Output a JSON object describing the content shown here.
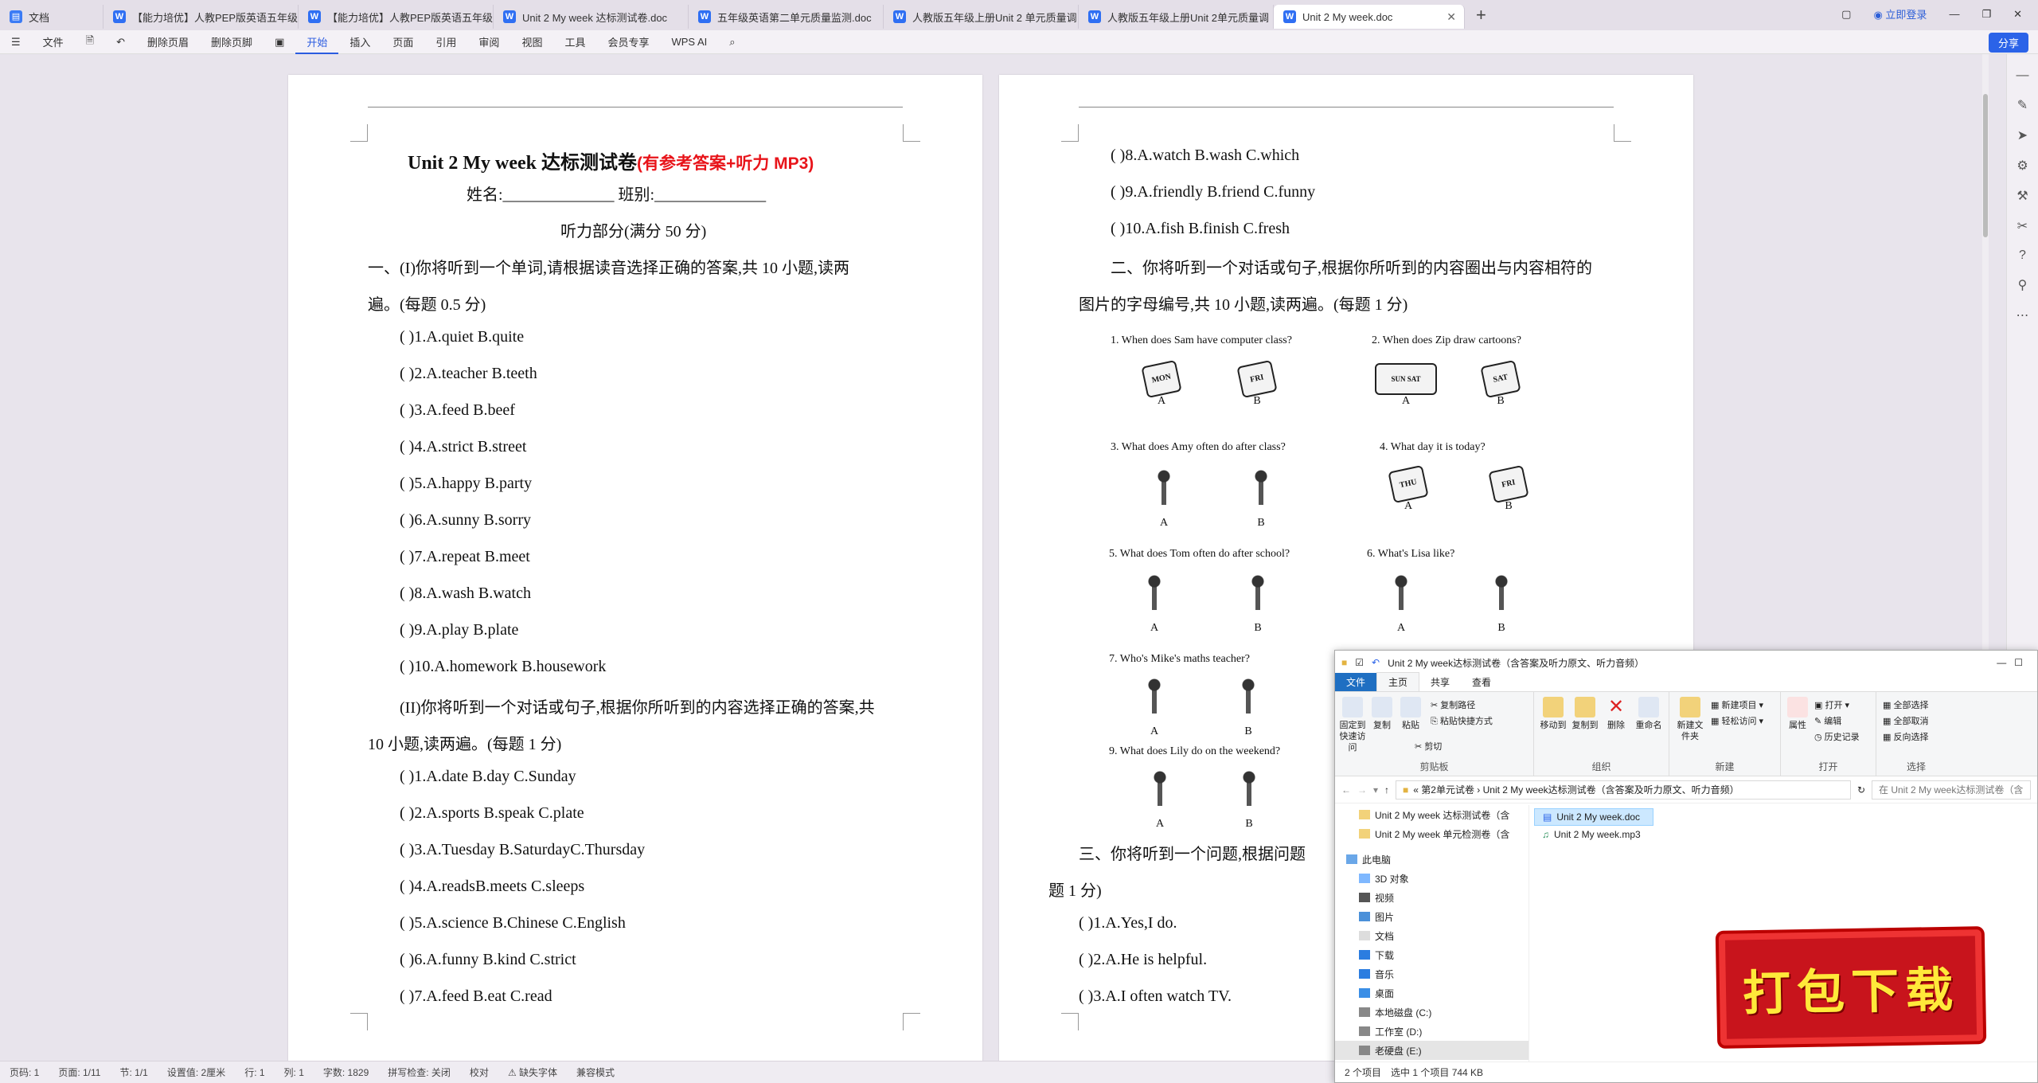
{
  "tabs": {
    "home": "文档",
    "items": [
      "【能力培优】人教PEP版英语五年级上",
      "【能力培优】人教PEP版英语五年级上",
      "Unit 2 My week 达标测试卷.doc",
      "五年级英语第二单元质量监测.doc",
      "人教版五年级上册Unit 2 单元质量调",
      "人教版五年级上册Unit 2单元质量调",
      "Unit 2   My week.doc"
    ],
    "login": "立即登录"
  },
  "menu": {
    "file": "文件",
    "tools": [
      "删除页眉",
      "删除页脚"
    ],
    "items": [
      "开始",
      "插入",
      "页面",
      "引用",
      "审阅",
      "视图",
      "工具",
      "会员专享"
    ],
    "ai": "WPS AI",
    "share": "分享"
  },
  "page1": {
    "title": "Unit 2    My week  达标测试卷",
    "title_note": "(有参考答案+听力 MP3)",
    "name_line": "姓名:______________       班别:______________",
    "listen_part": "听力部分(满分 50 分)",
    "section1_a": "一、(I)你将听到一个单词,请根据读音选择正确的答案,共 10 小题,读两",
    "section1_b": "遍。(每题 0.5 分)",
    "q1": [
      "(          )1.A.quiet          B.quite",
      "(          )2.A.teacher        B.teeth",
      "(          )3.A.feed               B.beef",
      "(          )4.A.strict             B.street",
      "(          )5.A.happy         B.party",
      "(          )6.A.sunny         B.sorry",
      "(          )7.A.repeat        B.meet",
      "(          )8.A.wash          B.watch",
      "(          )9.A.play              B.plate",
      "(          )10.A.homework   B.housework"
    ],
    "section2_a": "(II)你将听到一个对话或句子,根据你所听到的内容选择正确的答案,共",
    "section2_b": "10 小题,读两遍。(每题 1 分)",
    "q2": [
      "(                )1.A.date    B.day       C.Sunday",
      "(                )2.A.sports    B.speak    C.plate",
      "(                )3.A.Tuesday B.SaturdayC.Thursday",
      "(                )4.A.readsB.meets     C.sleeps",
      "(          )5.A.science    B.Chinese C.English",
      "(          )6.A.funny                   B.kind         C.strict",
      "(          )7.A.feed                     B.eat             C.read"
    ]
  },
  "page2": {
    "q1": [
      "(          )8.A.watch               B.wash          C.which",
      "(          )9.A.friendly             B.friend          C.funny",
      "(          )10.A.fish                 B.finish         C.fresh"
    ],
    "section2_a": "二、你将听到一个对话或句子,根据你所听到的内容圈出与内容相符的",
    "section2_b": "图片的字母编号,共 10 小题,读两遍。(每题 1 分)",
    "pic_questions": [
      "1.  When does Sam have computer class?",
      "2.  When does Zip draw cartoons?",
      "3.  What does Amy often do after class?",
      "4.  What day it is today?",
      "5.  What does Tom often do after school?",
      "6.  What's Lisa like?",
      "7.  Who's Mike's maths teacher?",
      "9.  What does Lily do on the weekend?"
    ],
    "cal_labels": [
      "MON",
      "FRI",
      "SUN SAT",
      "SAT",
      "THU",
      "FRI"
    ],
    "section3_a": "三、你将听到一个问题,根据问题",
    "section3_b": "题 1 分)",
    "q3": [
      "(          )1.A.Yes,I do.",
      "(          )2.A.He is helpful.",
      "(          )3.A.I often watch TV."
    ]
  },
  "statusbar": {
    "items": [
      "页码: 1",
      "页面: 1/11",
      "节: 1/1",
      "设置值: 2厘米",
      "行: 1",
      "列: 1",
      "字数: 1829",
      "拼写检查: 关闭",
      "校对",
      "缺失字体",
      "兼容模式"
    ]
  },
  "explorer": {
    "title": "Unit 2    My week达标测试卷（含答案及听力原文、听力音频）",
    "ribbon_tabs": [
      "文件",
      "主页",
      "共享",
      "查看"
    ],
    "groups": [
      "剪贴板",
      "组织",
      "新建",
      "打开",
      "选择"
    ],
    "buttons": {
      "pin": "固定到快速访问",
      "copy": "复制",
      "paste": "粘贴",
      "copy_path": "复制路径",
      "paste_shortcut": "粘贴快捷方式",
      "cut": "剪切",
      "move_to": "移动到",
      "copy_to": "复制到",
      "delete": "删除",
      "rename": "重命名",
      "new_folder": "新建文件夹",
      "new_item": "新建项目",
      "easy_access": "轻松访问",
      "properties": "属性",
      "open": "打开",
      "edit": "编辑",
      "history": "历史记录",
      "select_all": "全部选择",
      "select_none": "全部取消",
      "invert": "反向选择"
    },
    "address": "«  第2单元试卷  ›  Unit 2   My week达标测试卷（含答案及听力原文、听力音频）",
    "search": "在 Unit 2   My week达标测试卷（含...",
    "nav": [
      "Unit 2 My week 达标测试卷（含",
      "Unit 2 My week 单元检测卷（含",
      "此电脑",
      "3D 对象",
      "视频",
      "图片",
      "文档",
      "下载",
      "音乐",
      "桌面",
      "本地磁盘 (C:)",
      "工作室 (D:)",
      "老硬盘 (E:)"
    ],
    "files": [
      "Unit 2    My week.doc",
      "Unit 2    My week.mp3"
    ],
    "status": [
      "2 个项目",
      "选中 1 个项目  744 KB"
    ]
  },
  "banner": "打包下载"
}
